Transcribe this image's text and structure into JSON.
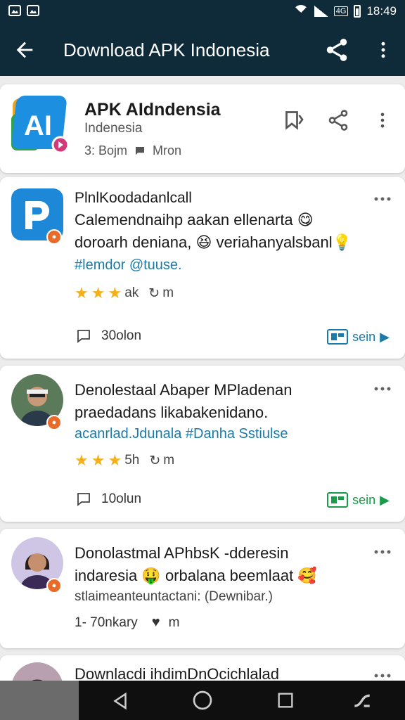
{
  "status": {
    "time": "18:49",
    "network": "4G"
  },
  "appbar": {
    "title": "Download APK Indonesia"
  },
  "app": {
    "name": "APK AIdndensia",
    "subtitle": "Indenesia",
    "meta_a": "3: Bojm",
    "meta_b": "Mron"
  },
  "posts": [
    {
      "title": "PlnlKoodadanlcall",
      "line1": "Calemendnaihp aakan ellenarta",
      "line2": "doroarh deniana,",
      "line2b": "veriahanyalsbanl",
      "tags": "#lemdor @tuuse.",
      "rating_text": "ak",
      "replies": "m",
      "comments": "30olon",
      "action": "sein"
    },
    {
      "title": "Denolestaal Abaper MPladenan",
      "line1": "praedadans likabakenidano.",
      "tags": "acanrlad.Jdunala #Danha Sstiulse",
      "rating_text": "5h",
      "replies": "m",
      "comments": "10olun",
      "action": "sein"
    },
    {
      "title": "Donolastmal APhbsK -dderesin",
      "line1": "indaresia",
      "line1b": "orbalana beemlaat",
      "line2": "stlaimeanteuntactani: (Dewnibar.)",
      "count": "1-  70nkary",
      "replies": "m"
    },
    {
      "title": "Downlacdi  ihdimDnOcichlalad"
    }
  ],
  "colors": {
    "bar": "#0f2a38",
    "accent": "#1c7ba6",
    "green": "#1a9a4a",
    "star": "#f2b01e"
  }
}
